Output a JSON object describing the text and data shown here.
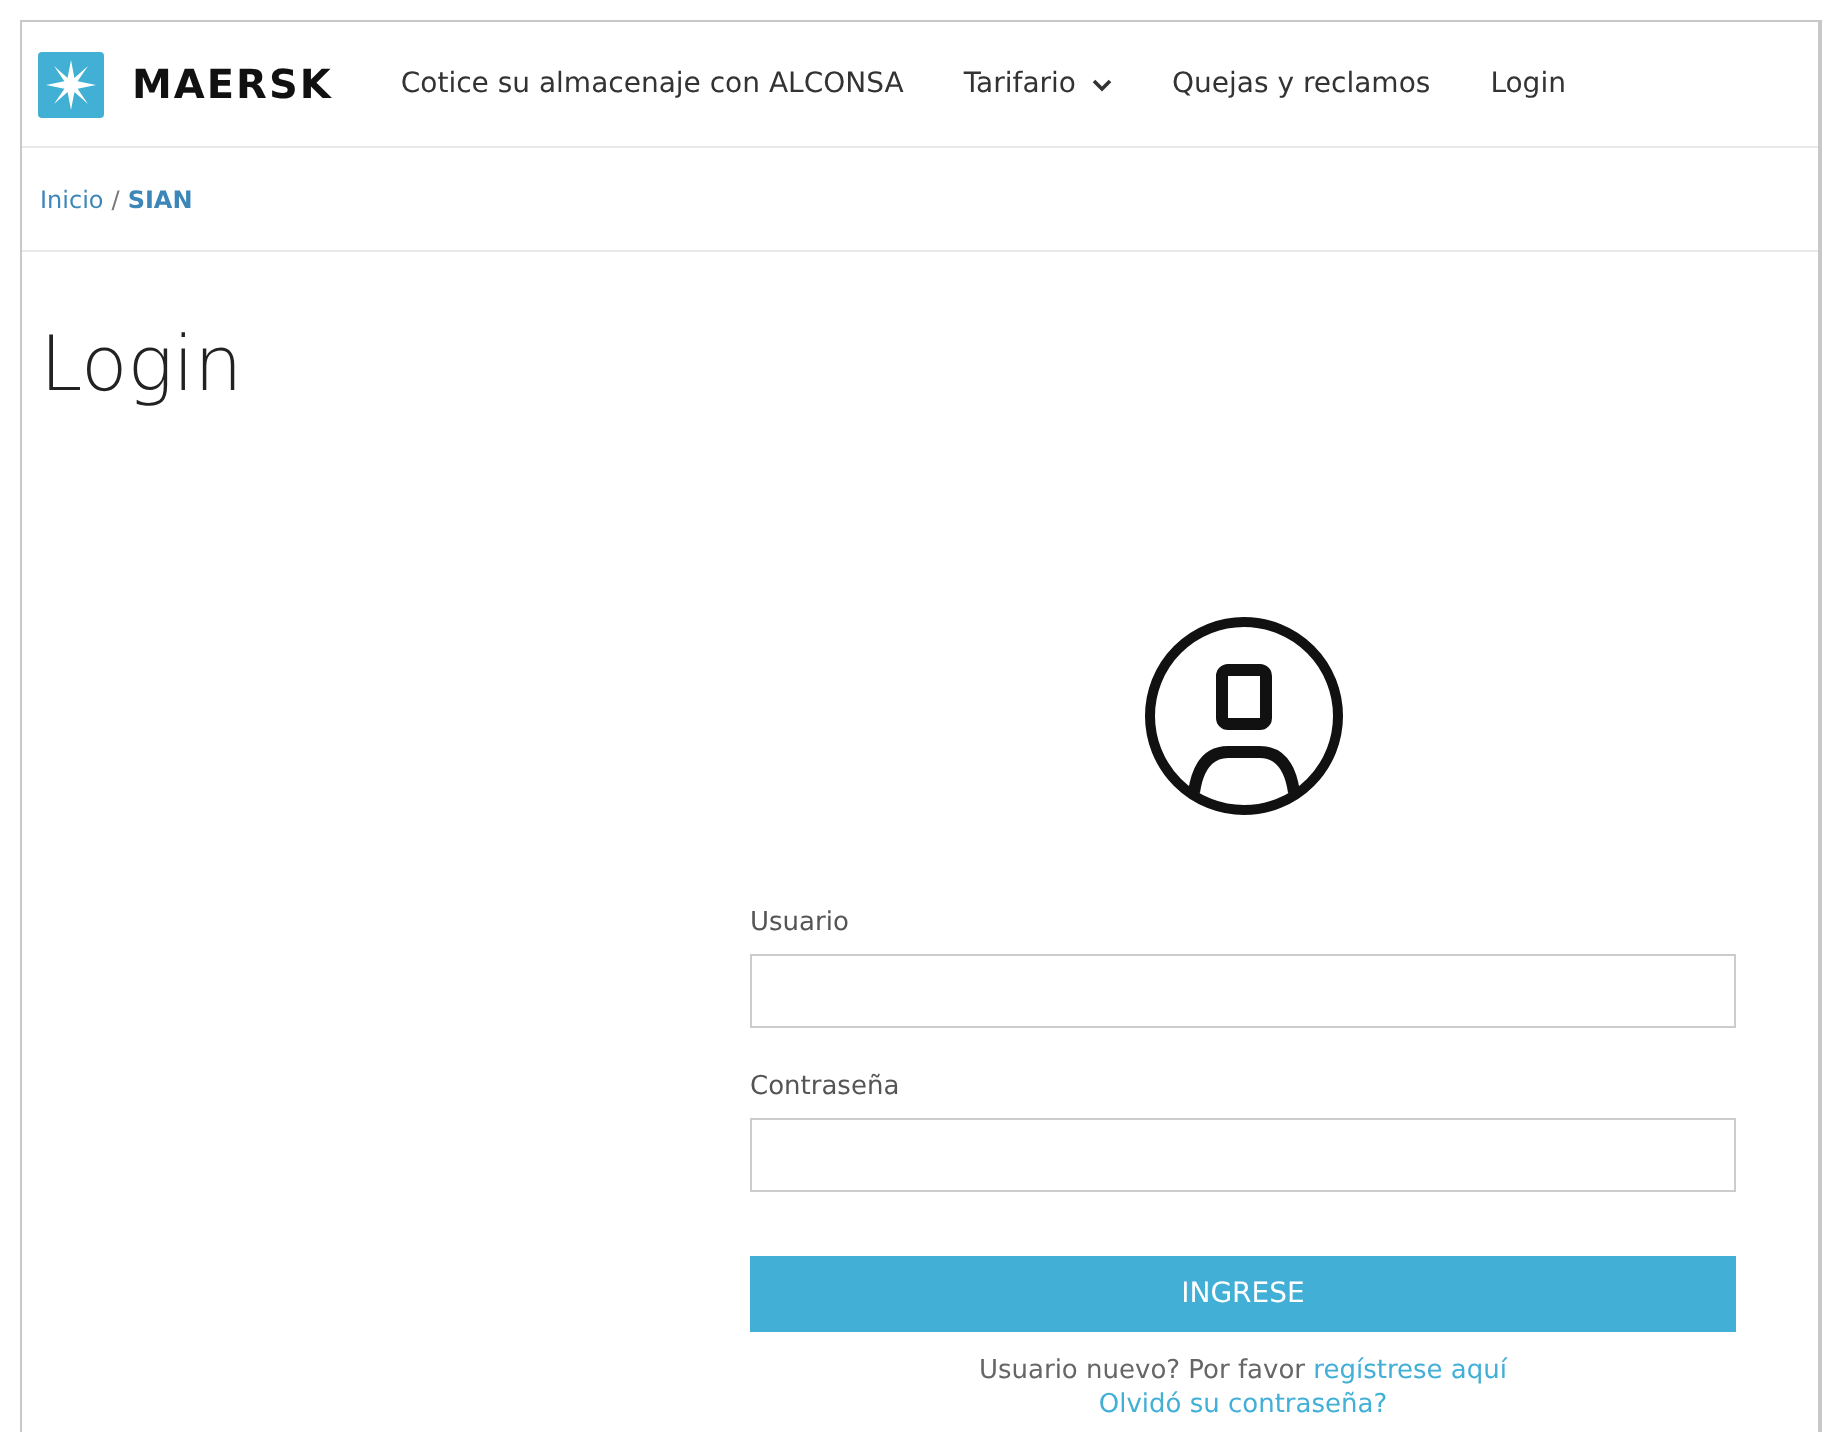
{
  "brand": {
    "name": "MAERSK"
  },
  "nav": [
    {
      "label": "Cotice su almacenaje con ALCONSA",
      "dropdown": false
    },
    {
      "label": "Tarifario",
      "dropdown": true
    },
    {
      "label": "Quejas y reclamos",
      "dropdown": false
    },
    {
      "label": "Login",
      "dropdown": false
    }
  ],
  "breadcrumb": [
    {
      "label": "Inicio",
      "current": false
    },
    {
      "label": "SIAN",
      "current": true
    }
  ],
  "breadcrumb_separator": "/",
  "page_title": "Login",
  "form": {
    "fields": [
      {
        "label": "Usuario"
      },
      {
        "label": "Contraseña"
      }
    ],
    "submit": "INGRESE",
    "register_text": "Usuario nuevo? Por favor",
    "register_link": "regístrese aquí",
    "forgot_link": "Olvidó su contraseña?"
  }
}
